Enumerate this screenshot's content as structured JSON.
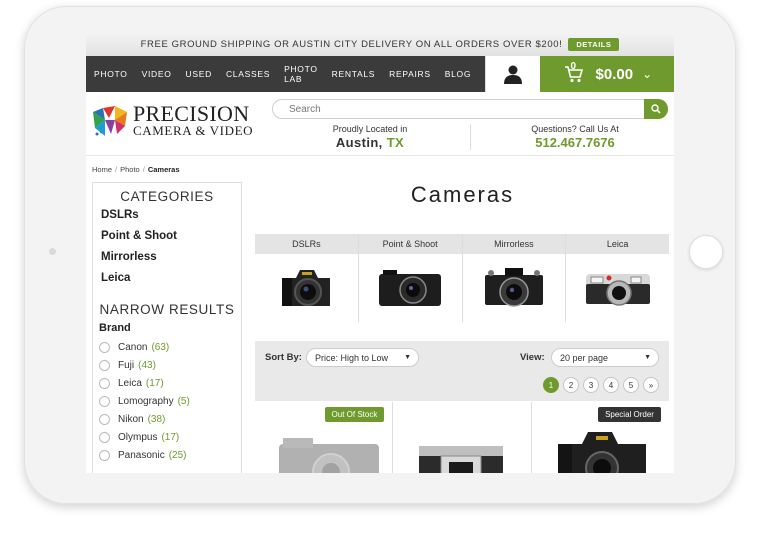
{
  "promo": {
    "text": "FREE GROUND SHIPPING OR AUSTIN CITY DELIVERY ON ALL ORDERS OVER $200!",
    "details": "DETAILS"
  },
  "nav": {
    "items": [
      "PHOTO",
      "VIDEO",
      "USED",
      "CLASSES",
      "PHOTO LAB",
      "RENTALS",
      "REPAIRS",
      "BLOG"
    ]
  },
  "cart": {
    "count": "0",
    "total": "$0.00"
  },
  "logo": {
    "line1": "PRECISION",
    "line2": "CAMERA & VIDEO"
  },
  "search": {
    "placeholder": "Search"
  },
  "location": {
    "label": "Proudly Located in",
    "city": "Austin,",
    "state": "TX"
  },
  "contact": {
    "label": "Questions? Call Us At",
    "phone": "512.467.7676"
  },
  "breadcrumb": {
    "home": "Home",
    "photo": "Photo",
    "current": "Cameras"
  },
  "sidebar": {
    "categories_title": "CATEGORIES",
    "categories": [
      "DSLRs",
      "Point & Shoot",
      "Mirrorless",
      "Leica"
    ],
    "narrow_title": "NARROW RESULTS",
    "brand_title": "Brand",
    "brands": [
      {
        "name": "Canon",
        "count": "(63)"
      },
      {
        "name": "Fuji",
        "count": "(43)"
      },
      {
        "name": "Leica",
        "count": "(17)"
      },
      {
        "name": "Lomography",
        "count": "(5)"
      },
      {
        "name": "Nikon",
        "count": "(38)"
      },
      {
        "name": "Olympus",
        "count": "(17)"
      },
      {
        "name": "Panasonic",
        "count": "(25)"
      }
    ]
  },
  "main": {
    "title": "Cameras",
    "category_tiles": [
      "DSLRs",
      "Point & Shoot",
      "Mirrorless",
      "Leica"
    ],
    "sort_label": "Sort By:",
    "sort_value": "Price: High to Low",
    "view_label": "View:",
    "view_value": "20 per page",
    "pages": [
      "1",
      "2",
      "3",
      "4",
      "5",
      "»"
    ],
    "products": [
      {
        "badge": "Out Of Stock"
      },
      {
        "badge": ""
      },
      {
        "badge": "Special Order"
      }
    ]
  },
  "colors": {
    "accent": "#6f9a2e",
    "nav_bg": "#3b3b3b",
    "badge_dark": "#333333"
  }
}
